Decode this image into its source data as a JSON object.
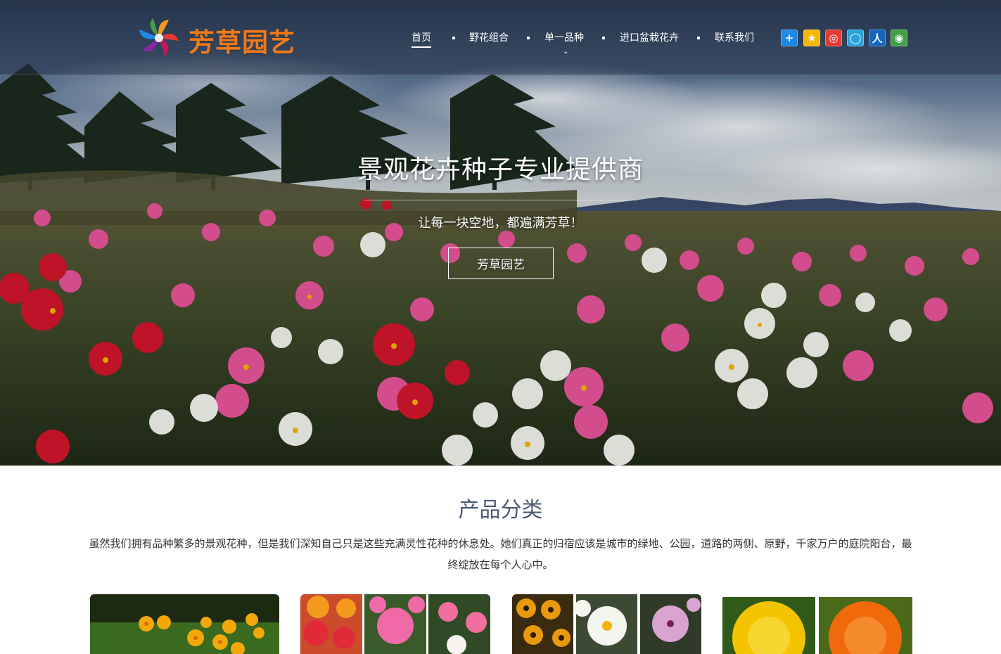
{
  "brand": {
    "name": "芳草园艺"
  },
  "nav": {
    "items": [
      {
        "label": "首页",
        "active": true
      },
      {
        "label": "野花组合"
      },
      {
        "label": "单一品种",
        "has_dropdown": true
      },
      {
        "label": "进口盆栽花卉"
      },
      {
        "label": "联系我们"
      }
    ]
  },
  "share": {
    "icons": [
      "share-more-icon",
      "qzone-icon",
      "weibo-icon",
      "tencent-weibo-icon",
      "renren-icon",
      "wechat-icon"
    ],
    "colors": [
      "#1e88e5",
      "#f5b700",
      "#e53935",
      "#29a3d8",
      "#1565c0",
      "#43a047"
    ]
  },
  "hero": {
    "title": "景观花卉种子专业提供商",
    "subtitle": "让每一块空地，都遍满芳草！",
    "button": "芳草园艺"
  },
  "products": {
    "title": "产品分类",
    "description": "虽然我们拥有品种繁多的景观花种，但是我们深知自己只是这些充满灵性花种的休息处。她们真正的归宿应该是城市的绿地、公园，道路的两侧、原野，千家万户的庭院阳台，最终绽放在每个人心中。"
  },
  "colors": {
    "logo_text": "#f07a1a",
    "section_title": "#4a5878",
    "header_overlay": "rgba(35,48,68,0.48)"
  }
}
